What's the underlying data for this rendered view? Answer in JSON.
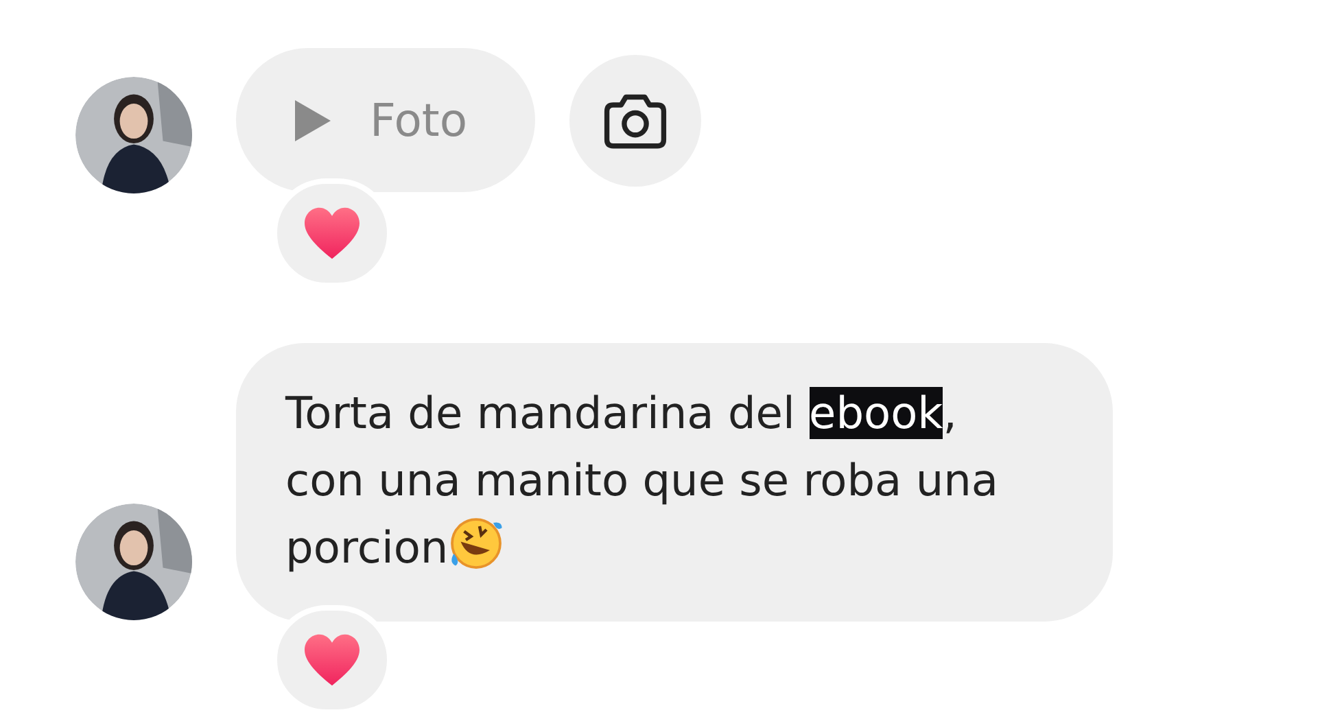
{
  "messages": [
    {
      "kind": "media",
      "label": "Foto",
      "camera_button": true,
      "reacted": true
    },
    {
      "kind": "text",
      "parts": [
        {
          "text": "Torta de mandarina del ",
          "highlighted": false
        },
        {
          "text": "ebook",
          "highlighted": true
        },
        {
          "text": ", con una manito que se roba una porcion",
          "highlighted": false
        }
      ],
      "emoji_after": true,
      "reacted": true
    }
  ]
}
